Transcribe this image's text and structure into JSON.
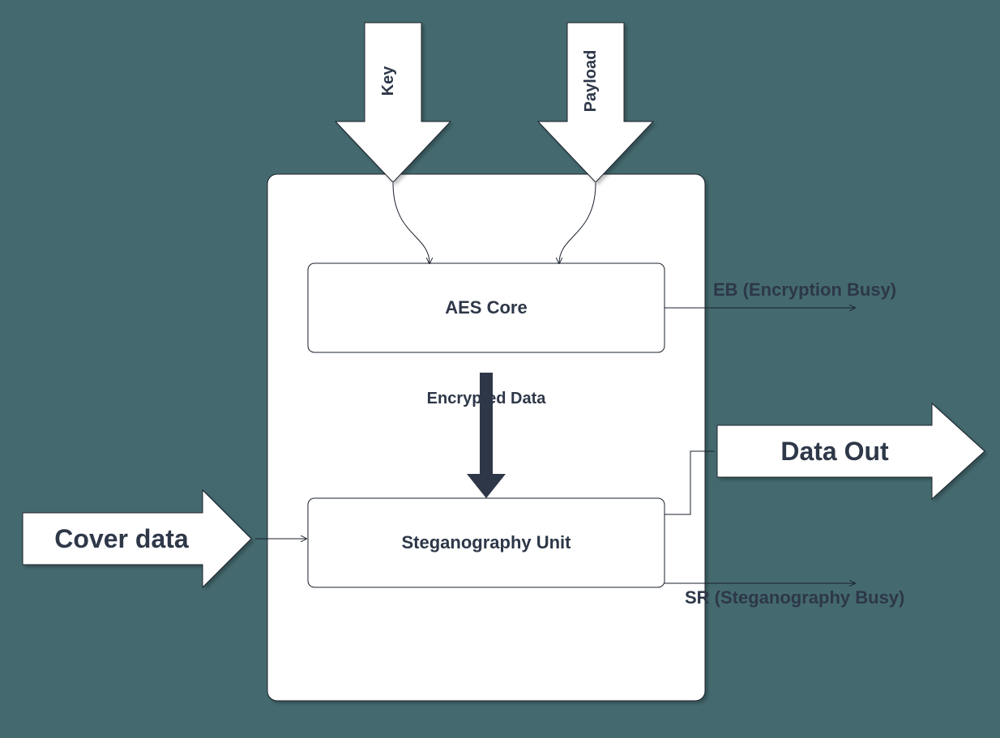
{
  "inputs": {
    "key": "Key",
    "payload": "Payload",
    "cover": "Cover data"
  },
  "blocks": {
    "aes": "AES Core",
    "steg": "Steganography Unit"
  },
  "signals": {
    "encrypted": "Encrypted Data",
    "eb": "EB (Encryption Busy)",
    "sr": "SR (Steganography Busy)",
    "dataout": "Data Out"
  }
}
